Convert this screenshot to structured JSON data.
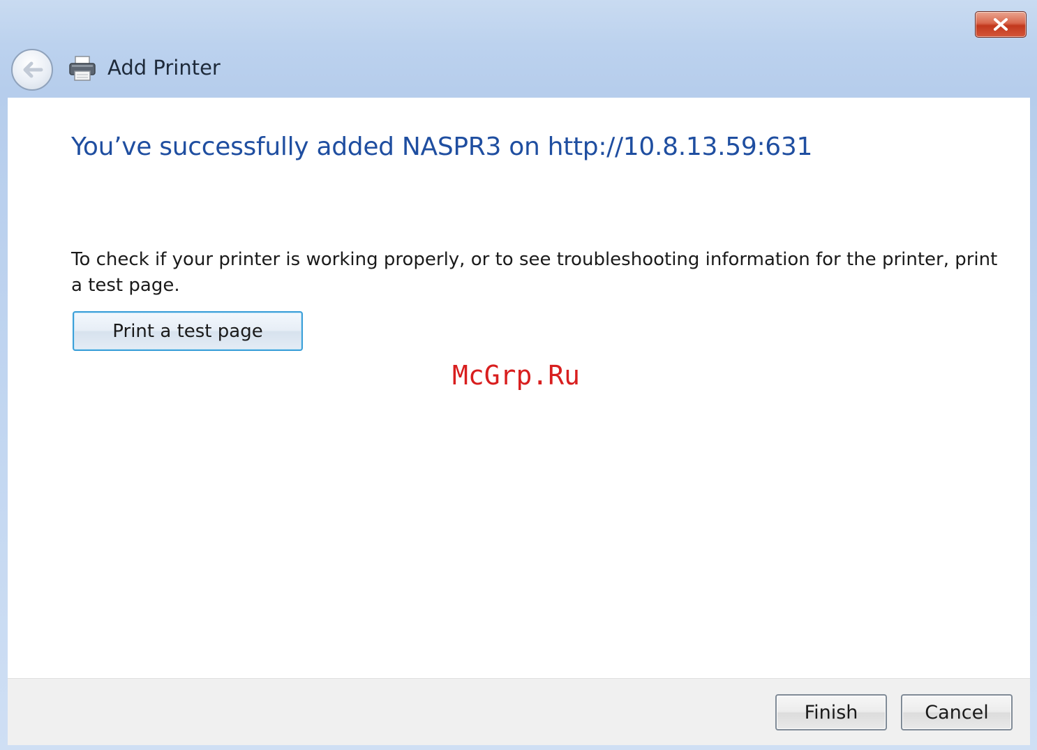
{
  "window": {
    "title": "Add Printer",
    "close_icon": "close-icon",
    "back_icon": "back-arrow-icon",
    "printer_icon": "printer-icon"
  },
  "main": {
    "heading": "You’ve successfully added NASPR3 on http://10.8.13.59:631",
    "description": "To check if your printer is working properly, or to see troubleshooting information for the printer, print a test page.",
    "test_button_label": "Print a test page"
  },
  "watermark": "McGrp.Ru",
  "footer": {
    "finish_label": "Finish",
    "cancel_label": "Cancel"
  },
  "colors": {
    "heading": "#1f4ea0",
    "watermark": "#d81e1e",
    "close_button": "#c2381d"
  }
}
